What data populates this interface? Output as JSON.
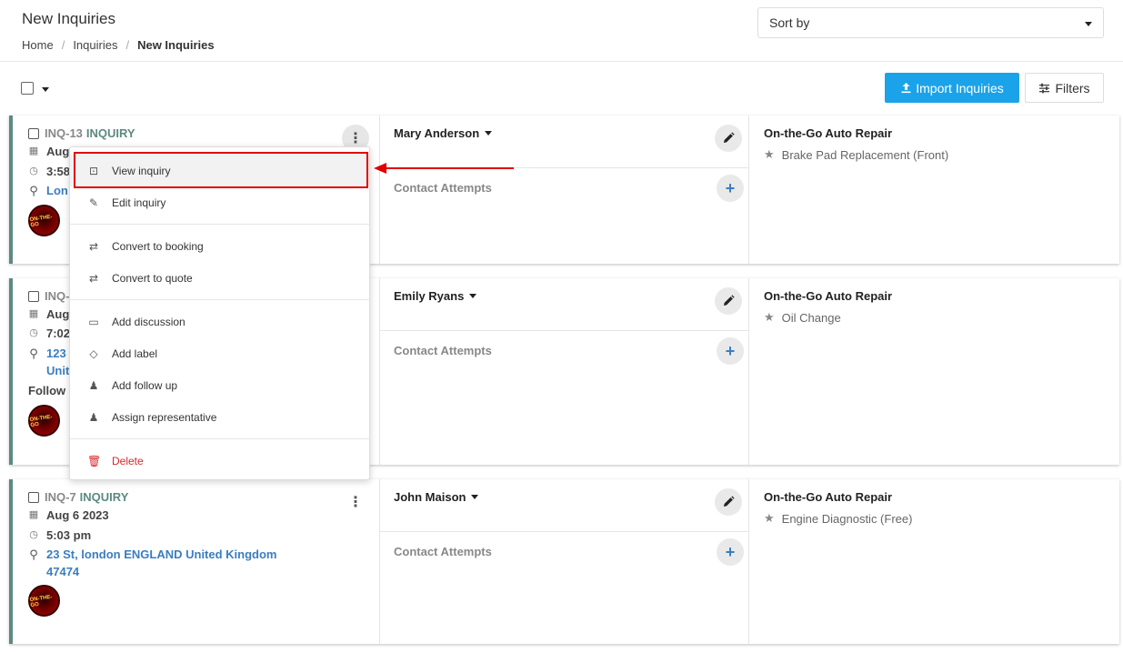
{
  "header": {
    "title": "New Inquiries",
    "breadcrumb": [
      "Home",
      "Inquiries",
      "New Inquiries"
    ],
    "sort_label": "Sort by"
  },
  "toolbar": {
    "import_label": "Import Inquiries",
    "filters_label": "Filters"
  },
  "inquiries": [
    {
      "id": "INQ-13",
      "type": "INQUIRY",
      "date": "Aug",
      "time": "3:58",
      "address": [
        "Lon"
      ],
      "follow": "",
      "customer": "Mary Anderson",
      "contact_label": "Contact Attempts",
      "shop": "On-the-Go Auto Repair",
      "service": "Brake Pad Replacement (Front)"
    },
    {
      "id": "INQ-",
      "type": "",
      "date": "Aug",
      "time": "7:02",
      "address": [
        "123",
        "Unit"
      ],
      "follow": "Follow",
      "customer": "Emily Ryans",
      "contact_label": "Contact Attempts",
      "shop": "On-the-Go Auto Repair",
      "service": "Oil Change"
    },
    {
      "id": "INQ-7",
      "type": "INQUIRY",
      "date": "Aug 6 2023",
      "time": "5:03 pm",
      "address": [
        "23 St, london ENGLAND United Kingdom",
        "47474"
      ],
      "follow": "",
      "customer": "John Maison",
      "contact_label": "Contact Attempts",
      "shop": "On-the-Go Auto Repair",
      "service": "Engine Diagnostic (Free)"
    }
  ],
  "logo_text": "ON-THE-GO",
  "context_menu": {
    "items": [
      {
        "label": "View inquiry",
        "icon": "search-document-icon"
      },
      {
        "label": "Edit inquiry",
        "icon": "edit-icon"
      },
      {
        "label": "Convert to booking",
        "icon": "exchange-icon"
      },
      {
        "label": "Convert to quote",
        "icon": "exchange-icon"
      },
      {
        "label": "Add discussion",
        "icon": "comments-icon"
      },
      {
        "label": "Add label",
        "icon": "tag-icon"
      },
      {
        "label": "Add follow up",
        "icon": "user-plus-icon"
      },
      {
        "label": "Assign representative",
        "icon": "user-plus-icon"
      },
      {
        "label": "Delete",
        "icon": "trash-icon"
      }
    ]
  },
  "colors": {
    "accent": "#1aa3e8",
    "card_border": "#5b8a80",
    "link": "#3a7dc0",
    "danger": "#d9262b",
    "annotation": "#e00000"
  }
}
